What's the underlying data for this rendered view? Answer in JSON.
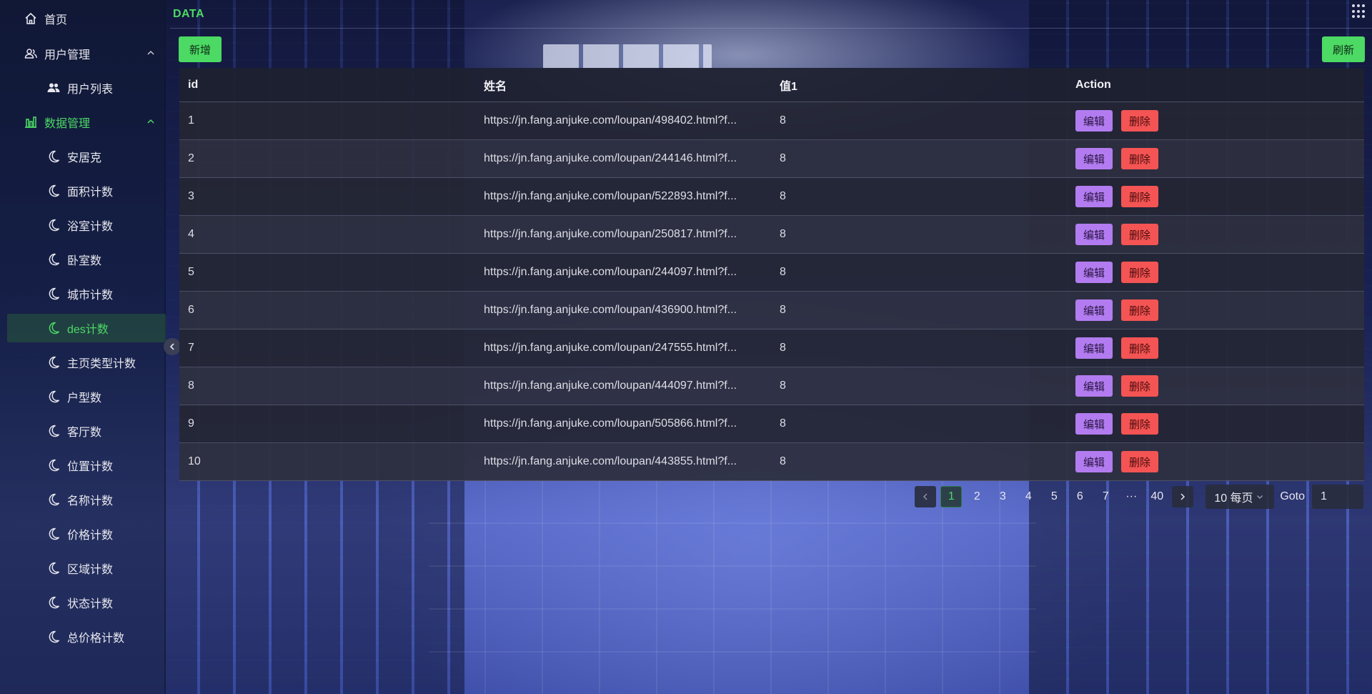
{
  "sidebar": {
    "items": [
      {
        "label": "首页",
        "icon": "home-icon"
      },
      {
        "label": "用户管理",
        "icon": "users-outline-icon"
      },
      {
        "label": "用户列表",
        "icon": "users-filled-icon"
      },
      {
        "label": "数据管理",
        "icon": "bar-chart-icon"
      },
      {
        "label": "安居克",
        "icon": "moon-icon"
      },
      {
        "label": "面积计数",
        "icon": "moon-icon"
      },
      {
        "label": "浴室计数",
        "icon": "moon-icon"
      },
      {
        "label": "卧室数",
        "icon": "moon-icon"
      },
      {
        "label": "城市计数",
        "icon": "moon-icon"
      },
      {
        "label": "des计数",
        "icon": "moon-icon"
      },
      {
        "label": "主页类型计数",
        "icon": "moon-icon"
      },
      {
        "label": "户型数",
        "icon": "moon-icon"
      },
      {
        "label": "客厅数",
        "icon": "moon-icon"
      },
      {
        "label": "位置计数",
        "icon": "moon-icon"
      },
      {
        "label": "名称计数",
        "icon": "moon-icon"
      },
      {
        "label": "价格计数",
        "icon": "moon-icon"
      },
      {
        "label": "区域计数",
        "icon": "moon-icon"
      },
      {
        "label": "状态计数",
        "icon": "moon-icon"
      },
      {
        "label": "总价格计数",
        "icon": "moon-icon"
      }
    ]
  },
  "header": {
    "title": "DATA"
  },
  "toolbar": {
    "add_label": "新增",
    "refresh_label": "刷新"
  },
  "table": {
    "columns": [
      "id",
      "姓名",
      "值1",
      "Action"
    ],
    "edit_label": "编辑",
    "delete_label": "删除",
    "rows": [
      {
        "id": "1",
        "name": "https://jn.fang.anjuke.com/loupan/498402.html?f...",
        "val": "8"
      },
      {
        "id": "2",
        "name": "https://jn.fang.anjuke.com/loupan/244146.html?f...",
        "val": "8"
      },
      {
        "id": "3",
        "name": "https://jn.fang.anjuke.com/loupan/522893.html?f...",
        "val": "8"
      },
      {
        "id": "4",
        "name": "https://jn.fang.anjuke.com/loupan/250817.html?f...",
        "val": "8"
      },
      {
        "id": "5",
        "name": "https://jn.fang.anjuke.com/loupan/244097.html?f...",
        "val": "8"
      },
      {
        "id": "6",
        "name": "https://jn.fang.anjuke.com/loupan/436900.html?f...",
        "val": "8"
      },
      {
        "id": "7",
        "name": "https://jn.fang.anjuke.com/loupan/247555.html?f...",
        "val": "8"
      },
      {
        "id": "8",
        "name": "https://jn.fang.anjuke.com/loupan/444097.html?f...",
        "val": "8"
      },
      {
        "id": "9",
        "name": "https://jn.fang.anjuke.com/loupan/505866.html?f...",
        "val": "8"
      },
      {
        "id": "10",
        "name": "https://jn.fang.anjuke.com/loupan/443855.html?f...",
        "val": "8"
      }
    ]
  },
  "pagination": {
    "pages": [
      "1",
      "2",
      "3",
      "4",
      "5",
      "6",
      "7",
      "···",
      "40"
    ],
    "current": "1",
    "page_size": "10 每页",
    "goto_label": "Goto",
    "goto_value": "1"
  },
  "colors": {
    "accent": "#4cd964",
    "edit": "#b27cf0",
    "delete": "#f45454"
  }
}
